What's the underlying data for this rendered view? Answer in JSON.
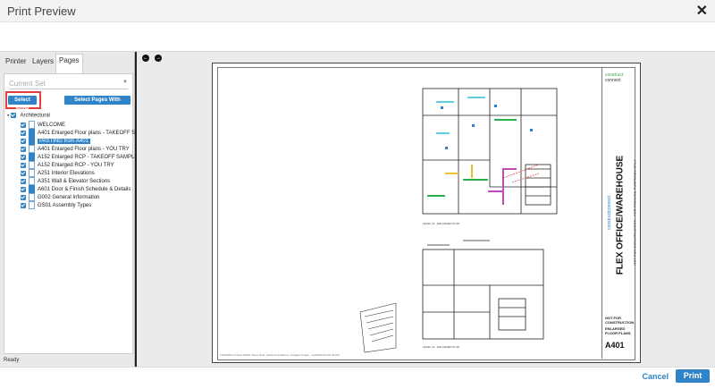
{
  "window": {
    "title": "Print Preview",
    "close_glyph": "✕"
  },
  "tabs": [
    {
      "label": "Printer"
    },
    {
      "label": "Layers"
    },
    {
      "label": "Pages"
    }
  ],
  "pages_panel": {
    "set_placeholder": "Current Set",
    "select_none_label": "Select None",
    "select_takeoff_label": "Select Pages With Takeoff",
    "tree": [
      {
        "label": "Architectural"
      },
      {
        "label": "WELCOME"
      },
      {
        "label": "A401 Enlarged Floor plans - TAKEOFF SA"
      },
      {
        "label": "PASTING from A401"
      },
      {
        "label": "A401 Enlarged Floor plans - YOU TRY"
      },
      {
        "label": "A152 Enlarged RCP - TAKEOFF SAMPLE"
      },
      {
        "label": "A152 Enlarged RCP - YOU TRY"
      },
      {
        "label": "A251 Interior Elevations"
      },
      {
        "label": "A351 Wall & Elevator Sections"
      },
      {
        "label": "A601 Door & Finish Schedule & Details"
      },
      {
        "label": "G002 General Information"
      },
      {
        "label": "GS01 Assembly Types"
      }
    ],
    "status": "Ready"
  },
  "sheet": {
    "logo_line1": "construct",
    "logo_line2": "connect",
    "project_title": "FLEX OFFICE/WAREHOUSE",
    "project_sub": "NOT FOR CONSTRUCTION - FOR TRAINING PURPOSES ONLY",
    "brand_vertical": "constructconnect",
    "note1": "NOT FOR CONSTRUCTION",
    "note2": "ENLARGED FLOOR PLANS",
    "sheet_number": "A401",
    "plan_label_1": "LEVEL 01 - ENLARGED PLAN",
    "plan_label_2": "LEVEL 01 - ENLARGED PLAN",
    "footnote": "TRAINING Printed 4/2021 Steve Reid, Wolski & Goldberg, Gridgate Project - 11/09/2019 9:50:36 AM"
  },
  "nav": {
    "prev": "←",
    "next": "→"
  },
  "footer": {
    "cancel_label": "Cancel",
    "print_label": "Print"
  },
  "colors": {
    "accent": "#2f83c6",
    "highlight": "#e53c3c"
  }
}
